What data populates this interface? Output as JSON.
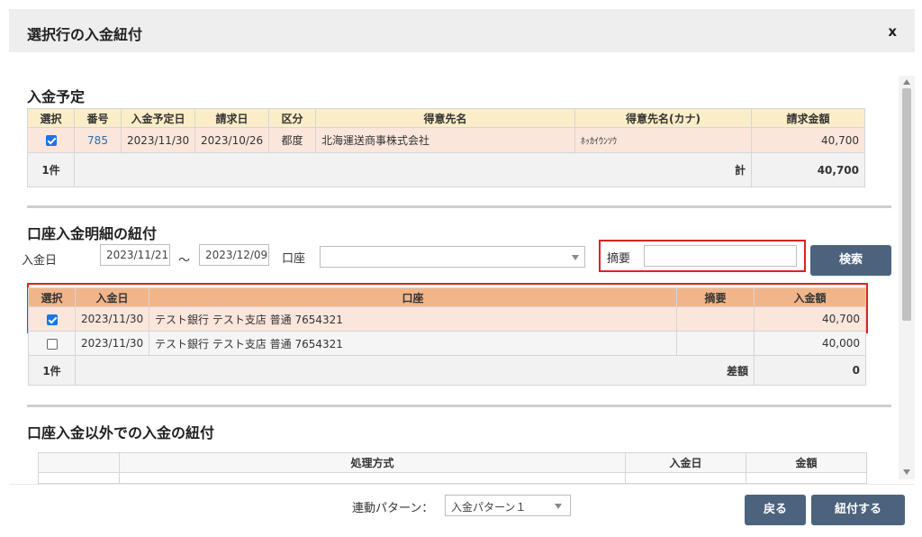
{
  "dialog": {
    "title": "選択行の入金紐付",
    "close_label": "x"
  },
  "planned": {
    "title": "入金予定",
    "headers": [
      "選択",
      "番号",
      "入金予定日",
      "請求日",
      "区分",
      "得意先名",
      "得意先名(カナ)",
      "請求金額"
    ],
    "row": {
      "checked": true,
      "number": "785",
      "planned_date": "2023/11/30",
      "billing_date": "2023/10/26",
      "category": "都度",
      "customer": "北海運送商事株式会社",
      "customer_kana": "ﾎｯｶｲｳﾝｿｳ",
      "amount": "40,700"
    },
    "summary": {
      "count": "1件",
      "total_label": "計",
      "total": "40,700"
    }
  },
  "account": {
    "title": "口座入金明細の紐付",
    "filter": {
      "date_label": "入金日",
      "date_from": "2023/11/21",
      "range_sep": "～",
      "date_to": "2023/12/09",
      "account_label": "口座",
      "account_value": "",
      "memo_label": "摘要",
      "memo_value": "",
      "search_button": "検索"
    },
    "headers": [
      "選択",
      "入金日",
      "口座",
      "摘要",
      "入金額"
    ],
    "rows": [
      {
        "checked": true,
        "date": "2023/11/30",
        "account": "テスト銀行 テスト支店 普通 7654321",
        "memo": "",
        "amount": "40,700"
      },
      {
        "checked": false,
        "date": "2023/11/30",
        "account": "テスト銀行 テスト支店 普通 7654321",
        "memo": "",
        "amount": "40,000"
      }
    ],
    "summary": {
      "count": "1件",
      "diff_label": "差額",
      "diff": "0"
    }
  },
  "other": {
    "title": "口座入金以外での入金の紐付",
    "headers": [
      "",
      "処理方式",
      "入金日",
      "金額"
    ]
  },
  "footer": {
    "pattern_label": "連動パターン：",
    "pattern_value": "入金パターン１",
    "back_button": "戻る",
    "link_button": "紐付する"
  },
  "colors": {
    "accent_button": "#4c637e",
    "highlight_red": "#e02020",
    "planned_header": "#fbedc8",
    "account_header": "#f1b58a",
    "selected_row": "#fbe6dc"
  }
}
